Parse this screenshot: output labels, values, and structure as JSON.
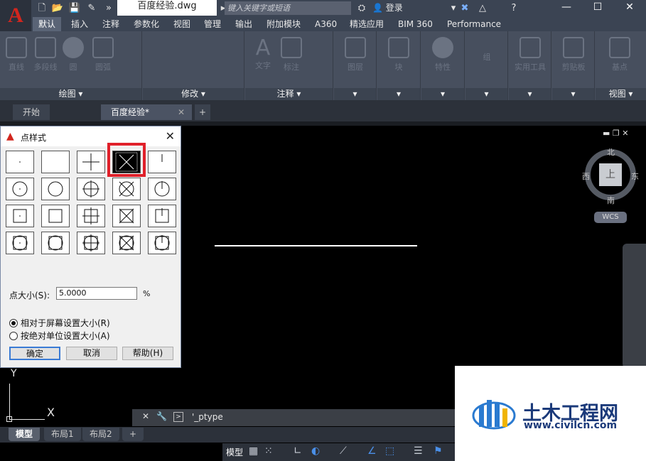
{
  "titlebar": {
    "doc_name": "百度经验.dwg",
    "search_placeholder": "键入关键字或短语",
    "login": "登录"
  },
  "ribbon_tabs": [
    "默认",
    "插入",
    "注释",
    "参数化",
    "视图",
    "管理",
    "输出",
    "附加模块",
    "A360",
    "精选应用",
    "BIM 360",
    "Performance"
  ],
  "ribbon_panels": {
    "draw": {
      "label": "绘图 ▾",
      "tools": [
        "直线",
        "多段线",
        "圆",
        "圆弧"
      ]
    },
    "modify": {
      "label": "修改 ▾"
    },
    "annotation": {
      "label": "注释 ▾",
      "tools": [
        "文字",
        "标注"
      ]
    },
    "layers": "图层",
    "block": "块",
    "properties": "特性",
    "groups": "组",
    "utilities": "实用工具",
    "clipboard": "剪贴板",
    "base": "基点",
    "view": {
      "label": "视图 ▾"
    }
  },
  "file_tabs": [
    "开始",
    "百度经验*"
  ],
  "viewcube": {
    "north": "北",
    "south": "南",
    "east": "东",
    "west": "西",
    "face": "上",
    "wcs": "WCS"
  },
  "dialog": {
    "title": "点样式",
    "size_label": "点大小(S):",
    "size_value": "5.0000",
    "size_unit": "%",
    "radio_relative": "相对于屏幕设置大小(R)",
    "radio_absolute": "按绝对单位设置大小(A)",
    "ok": "确定",
    "cancel": "取消",
    "help": "帮助(H)",
    "selected_style_index": 3
  },
  "ucs": {
    "x": "X",
    "y": "Y"
  },
  "command_line": {
    "text": "'_ptype"
  },
  "layout_tabs": [
    "模型",
    "布局1",
    "布局2"
  ],
  "status": {
    "model": "模型"
  },
  "watermark": {
    "title": "土木工程网",
    "url": "www.civilcn.com"
  },
  "colors": {
    "accent_red": "#e0202a",
    "ribbon_bg": "#474f5e",
    "dialog_bg": "#f0f0f0"
  }
}
